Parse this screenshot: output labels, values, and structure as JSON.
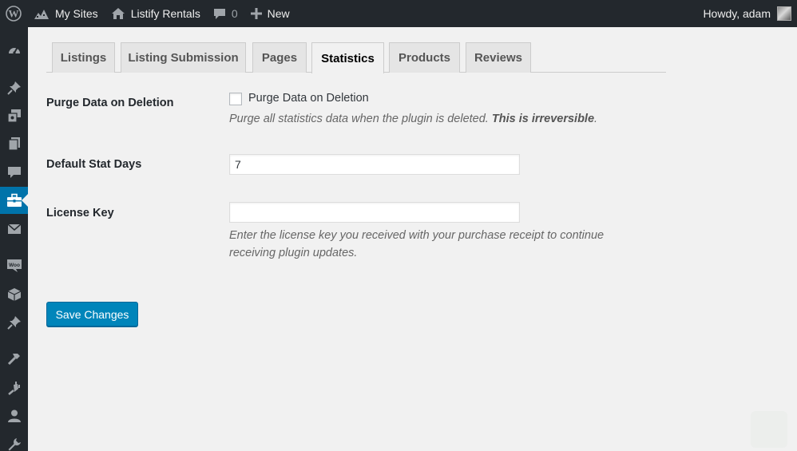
{
  "admin_bar": {
    "my_sites": "My Sites",
    "site_name": "Listify Rentals",
    "comments_count": "0",
    "new_label": "New",
    "howdy": "Howdy, adam"
  },
  "sidebar": {
    "icons": [
      "dashboard-icon",
      "pin-icon",
      "media-icon",
      "pages-icon",
      "comments-icon",
      "briefcase-icon",
      "mail-icon",
      "woocommerce-icon",
      "box-icon",
      "pin-icon",
      "hammer-icon",
      "plugin-icon",
      "user-icon",
      "wrench-icon"
    ],
    "current": "briefcase-icon"
  },
  "tabs": [
    {
      "label": "Listings",
      "active": false
    },
    {
      "label": "Listing Submission",
      "active": false
    },
    {
      "label": "Pages",
      "active": false
    },
    {
      "label": "Statistics",
      "active": true
    },
    {
      "label": "Products",
      "active": false
    },
    {
      "label": "Reviews",
      "active": false
    }
  ],
  "form": {
    "purge": {
      "label": "Purge Data on Deletion",
      "checkbox_label": "Purge Data on Deletion",
      "checked": false,
      "desc_text": "Purge all statistics data when the plugin is deleted.",
      "desc_bold": "This is irreversible"
    },
    "stat_days": {
      "label": "Default Stat Days",
      "value": "7"
    },
    "license": {
      "label": "License Key",
      "value": "",
      "desc_line1": "Enter the license key you received with your purchase receipt to continue",
      "desc_line2": "receiving plugin updates."
    },
    "save_label": "Save Changes"
  },
  "colors": {
    "admin_bar": "#23282d",
    "accent": "#0073aa",
    "button": "#0085ba",
    "background": "#f1f1f1"
  }
}
